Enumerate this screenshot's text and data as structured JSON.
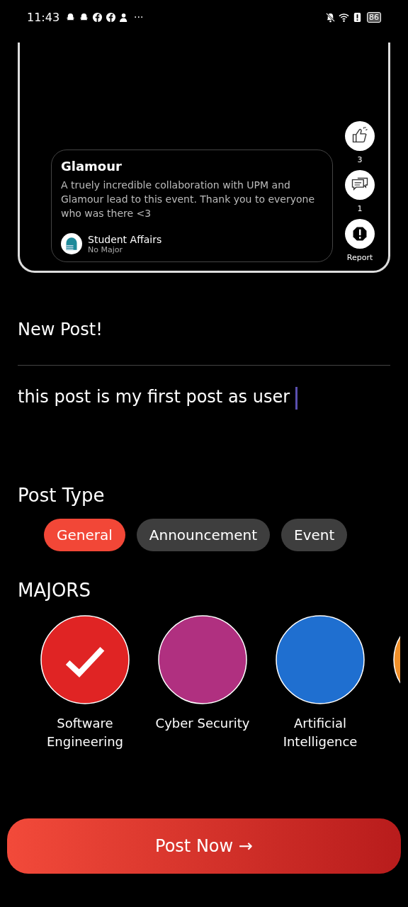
{
  "status_bar": {
    "time": "11:43",
    "more": "···",
    "battery": "86"
  },
  "preview": {
    "title": "Glamour",
    "body": "A truely incredible collaboration with UPM and Glamour lead to this event. Thank you to everyone who was there <3",
    "author": "Student Affairs",
    "major": "No Major",
    "actions": [
      {
        "kind": "like",
        "count": "3"
      },
      {
        "kind": "comment",
        "count": "1"
      },
      {
        "kind": "report",
        "count": "Report"
      }
    ]
  },
  "title_field": {
    "value": "New Post!"
  },
  "body_field": {
    "value": "this post is my first post as user"
  },
  "post_type": {
    "heading": "Post Type",
    "options": [
      {
        "label": "General",
        "selected": true
      },
      {
        "label": "Announcement",
        "selected": false
      },
      {
        "label": "Event",
        "selected": false
      }
    ]
  },
  "majors": {
    "heading": "MAJORS",
    "items": [
      {
        "name": "Software Engineering",
        "color": "#e02424",
        "selected": true
      },
      {
        "name": "Cyber Security",
        "color": "#b03080",
        "selected": false
      },
      {
        "name": "Artificial Intelligence",
        "color": "#1f6fd0",
        "selected": false
      },
      {
        "color": "#f0902a"
      }
    ]
  },
  "submit": {
    "label": "Post Now →"
  }
}
